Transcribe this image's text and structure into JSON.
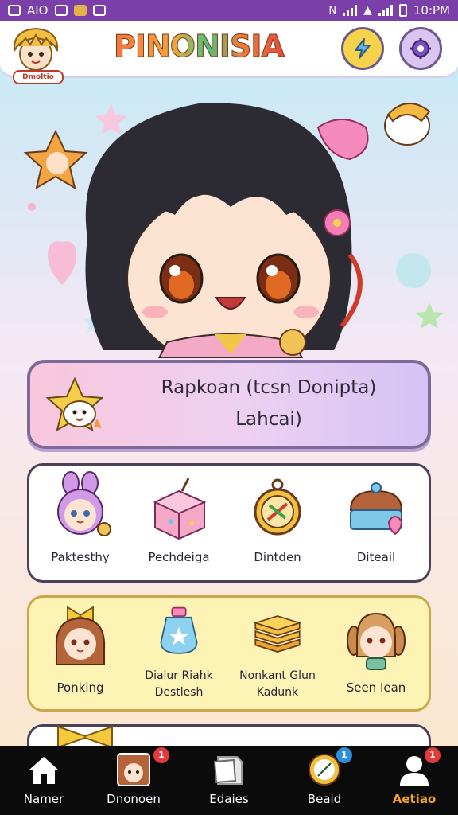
{
  "status_bar": {
    "left_text": "AIO",
    "time": "10:PM"
  },
  "header": {
    "title": "PINONISIA",
    "logo_text": "Dmoltio",
    "buttons": [
      {
        "icon": "lightning-icon"
      },
      {
        "icon": "gear-icon"
      }
    ]
  },
  "banner": {
    "line1": "Rapkoan (tcsn Donipta)",
    "line2": "Lahcai)",
    "icon": "star-mascot-icon"
  },
  "panel_row1": {
    "items": [
      {
        "label": "Paktesthy",
        "icon": "bunny-girl-icon"
      },
      {
        "label": "Pechdeiga",
        "icon": "gift-box-icon"
      },
      {
        "label": "Dintden",
        "icon": "pocket-watch-icon"
      },
      {
        "label": "Diteail",
        "icon": "cake-icon"
      }
    ]
  },
  "panel_row2": {
    "items": [
      {
        "label": "Ponking",
        "icon": "bow-girl-icon"
      },
      {
        "label": "Dialur Riahk Destlesh",
        "icon": "potion-icon"
      },
      {
        "label": "Nonkant Glun Kadunk",
        "icon": "pancake-icon"
      },
      {
        "label": "Seen Iean",
        "icon": "pigtail-girl-icon"
      }
    ]
  },
  "bottom_nav": {
    "items": [
      {
        "label": "Namer",
        "icon": "home-icon",
        "badge": ""
      },
      {
        "label": "Dnonoen",
        "icon": "character-icon",
        "badge": "1"
      },
      {
        "label": "Edaies",
        "icon": "document-icon",
        "badge": ""
      },
      {
        "label": "Beaid",
        "icon": "compass-icon",
        "badge": "1"
      },
      {
        "label": "Aetiao",
        "icon": "profile-icon",
        "badge": "1"
      }
    ]
  },
  "colors": {
    "status_bar": "#7a3fa8",
    "nav_active": "#f3a323",
    "badge_red": "#e23b3b",
    "badge_blue": "#2d8fe0"
  }
}
